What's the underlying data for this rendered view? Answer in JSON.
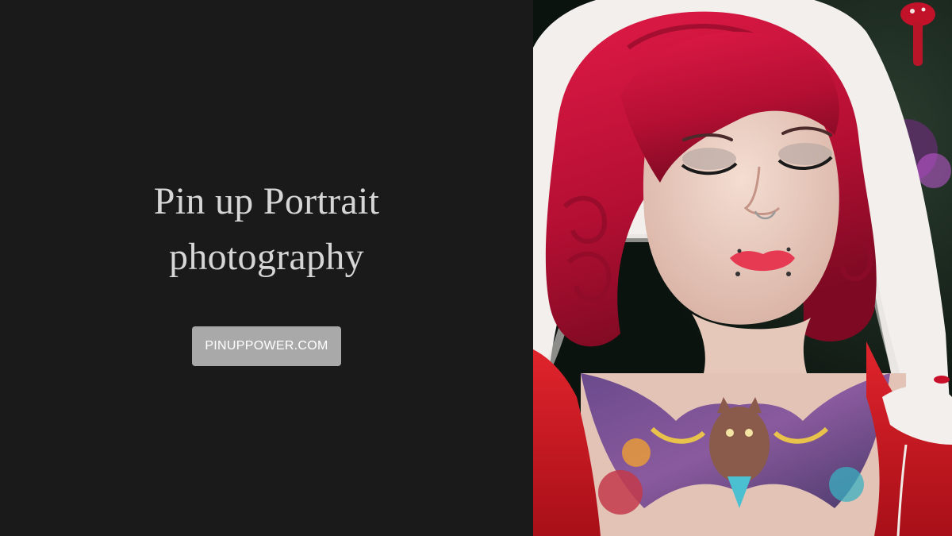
{
  "hero": {
    "title_line1": "Pin up Portrait",
    "title_line2": "photography",
    "button_label": "PINUPPOWER.COM"
  },
  "photo": {
    "subject": "portrait-photo"
  },
  "colors": {
    "background": "#1a1a1a",
    "title_text": "#d6d6d6",
    "button_bg": "#a9a9a9",
    "button_text": "#ffffff",
    "hair": "#c8123a",
    "hood_red": "#d41a24",
    "fur_white": "#f4f1ef"
  }
}
